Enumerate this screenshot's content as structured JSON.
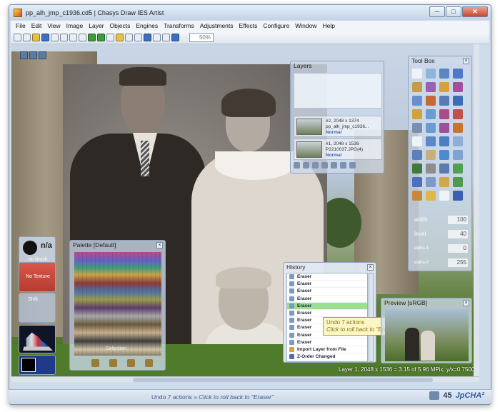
{
  "window": {
    "title": "pp_alh_jmp_c1936.cd5 | Chasys Draw IES Artist",
    "minimize": "─",
    "maximize": "□",
    "close": "✕"
  },
  "menu": [
    "File",
    "Edit",
    "View",
    "Image",
    "Layer",
    "Objects",
    "Engines",
    "Transforms",
    "Adjustments",
    "Effects",
    "Configure",
    "Window",
    "Help"
  ],
  "toolbar": {
    "zoom": "50%"
  },
  "layers_panel": {
    "title": "Layers",
    "layers": [
      {
        "name": "#2, 2048 x 1374",
        "file": "pp_alh_jmp_c1936...",
        "mode": "Normal"
      },
      {
        "name": "#1, 2048 x 1536",
        "file": "P2210037.JPG(4)",
        "mode": "Normal"
      }
    ]
  },
  "toolbox": {
    "title": "Tool Box",
    "params": [
      {
        "label": "width",
        "value": "100"
      },
      {
        "label": "level",
        "value": "40"
      },
      {
        "label": "alpha-1",
        "value": "0"
      },
      {
        "label": "alpha-2",
        "value": "255"
      }
    ]
  },
  "palette": {
    "title": "Palette [Default]",
    "hint": "Selection"
  },
  "history": {
    "title": "History",
    "items": [
      "Eraser",
      "Eraser",
      "Eraser",
      "Eraser",
      "Eraser",
      "Eraser",
      "Eraser",
      "Eraser",
      "Eraser",
      "Eraser",
      "Import Layer from File",
      "Z-Order Changed"
    ],
    "selected_index": 4
  },
  "tooltip": {
    "line1": "Undo 7 actions",
    "line2": "Click to roll back to \"Eraser\""
  },
  "preview": {
    "title": "Preview [sRGB]"
  },
  "brush": {
    "state": "n/a",
    "label": "no brush"
  },
  "texture": {
    "label": "No Texture"
  },
  "shift": {
    "label": "Shift"
  },
  "canvas_status": "Layer 1, 2048 x 1536 = 3.15 of 5.96 MPix, y/x=0.7500",
  "statusbar": {
    "main": "Undo 7 actions",
    "sep": " » ",
    "hint": "Click to roll back to \"Eraser\"",
    "count": "45",
    "format": "JpCHA²"
  }
}
